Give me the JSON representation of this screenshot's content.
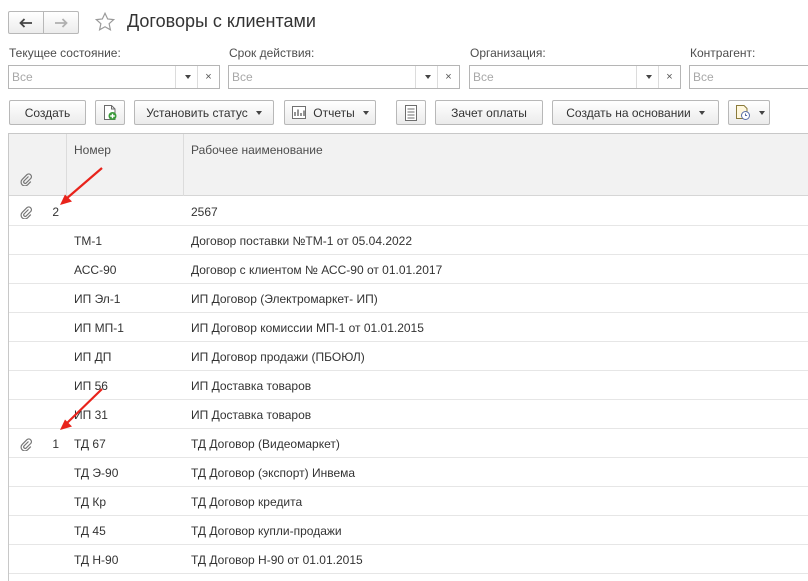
{
  "window": {
    "title": "Договоры с клиентами"
  },
  "nav": {
    "back_icon": "arrow-left-icon",
    "forward_icon": "arrow-right-icon",
    "favorite_icon": "star-icon"
  },
  "filters": [
    {
      "label": "Текущее состояние:",
      "placeholder": "Все"
    },
    {
      "label": "Срок действия:",
      "placeholder": "Все"
    },
    {
      "label": "Организация:",
      "placeholder": "Все"
    },
    {
      "label": "Контрагент:",
      "placeholder": "Все"
    }
  ],
  "toolbar": {
    "create": "Создать",
    "set_status": "Установить статус",
    "reports": "Отчеты",
    "payment_offset": "Зачет оплаты",
    "create_based_on": "Создать на основании"
  },
  "table": {
    "columns": {
      "number": "Номер",
      "name": "Рабочее наименование"
    },
    "rows": [
      {
        "files": "2",
        "number": "",
        "name": "2567"
      },
      {
        "files": "",
        "number": "ТМ-1",
        "name": "Договор поставки №ТМ-1 от 05.04.2022"
      },
      {
        "files": "",
        "number": "АСС-90",
        "name": "Договор с клиентом № АСС-90 от 01.01.2017"
      },
      {
        "files": "",
        "number": "ИП Эл-1",
        "name": "ИП Договор (Электромаркет- ИП)"
      },
      {
        "files": "",
        "number": "ИП МП-1",
        "name": "ИП Договор комиссии МП-1 от 01.01.2015"
      },
      {
        "files": "",
        "number": "ИП ДП",
        "name": "ИП Договор продажи (ПБОЮЛ)"
      },
      {
        "files": "",
        "number": "ИП 56",
        "name": "ИП Доставка товаров"
      },
      {
        "files": "",
        "number": "ИП 31",
        "name": "ИП Доставка товаров"
      },
      {
        "files": "1",
        "number": "ТД 67",
        "name": "ТД Договор (Видеомаркет)"
      },
      {
        "files": "",
        "number": "ТД Э-90",
        "name": "ТД Договор (экспорт) Инвема"
      },
      {
        "files": "",
        "number": "ТД Кр",
        "name": "ТД Договор кредита"
      },
      {
        "files": "",
        "number": "ТД 45",
        "name": "ТД Договор купли-продажи"
      },
      {
        "files": "",
        "number": "ТД Н-90",
        "name": "ТД Договор Н-90 от 01.01.2015"
      }
    ]
  },
  "colors": {
    "annotation_arrow": "#e8231b",
    "accent_green": "#3a9a3a"
  }
}
